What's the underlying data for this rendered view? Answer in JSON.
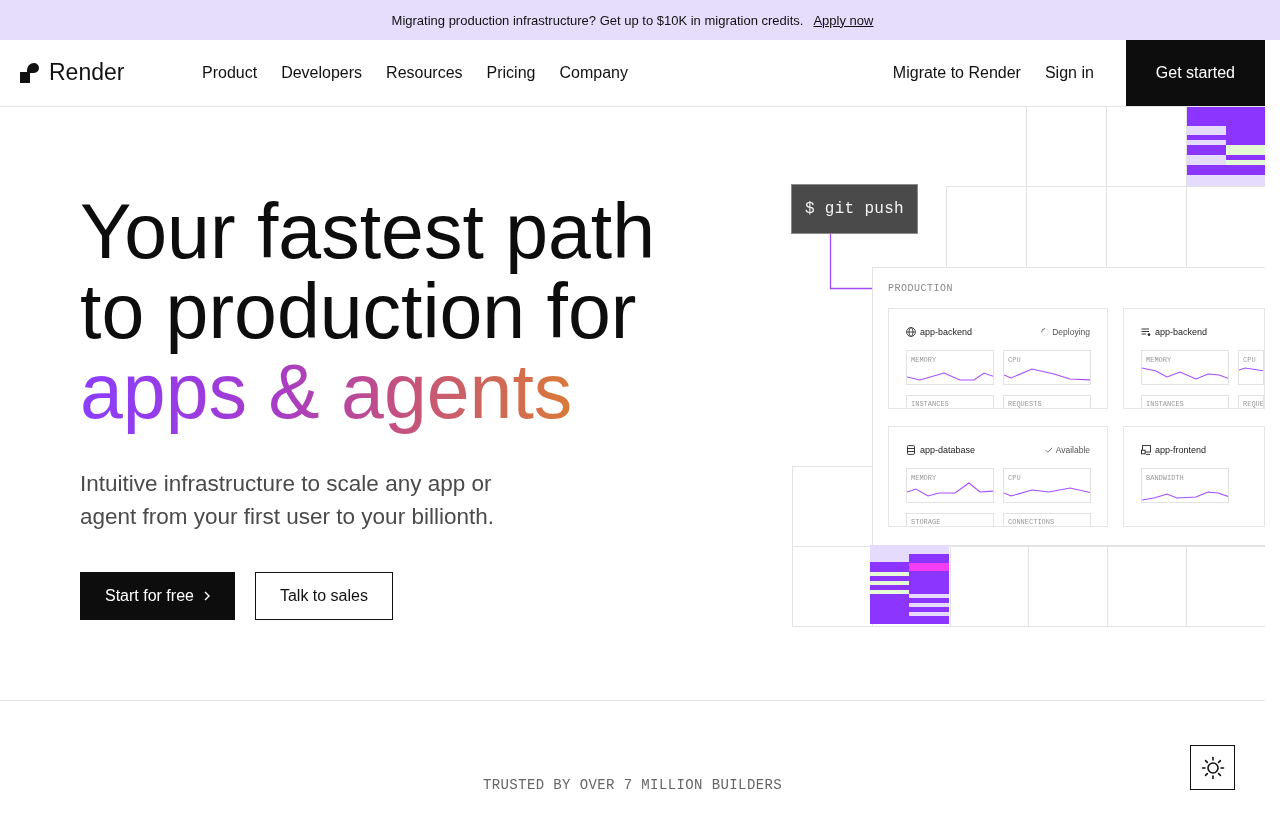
{
  "banner": {
    "text": "Migrating production infrastructure? Get up to $10K in migration credits.",
    "link": "Apply now"
  },
  "nav": {
    "brand": "Render",
    "links": [
      "Product",
      "Developers",
      "Resources",
      "Pricing",
      "Company"
    ],
    "actions": [
      {
        "label": "Migrate to Render",
        "kind": "link"
      },
      {
        "label": "Sign in",
        "kind": "link"
      },
      {
        "label": "Get started",
        "kind": "primary"
      }
    ]
  },
  "hero": {
    "heading": "Your fastest path to production for",
    "highlight": "apps & agents",
    "subheading": "Intuitive infrastructure to scale any app or agent from your first user to your billionth.",
    "buttons": [
      {
        "label": "Start for free",
        "kind": "primary"
      },
      {
        "label": "Talk to sales",
        "kind": "secondary"
      }
    ]
  },
  "illustration": {
    "command": "$ git push",
    "panel": {
      "title": "PRODUCTION",
      "services": [
        {
          "kind": "web",
          "name": "app-backend",
          "status": {
            "kind": "deploying",
            "label": "Deploying"
          },
          "metrics": [
            "MEMORY",
            "CPU"
          ],
          "more_metrics": [
            "INSTANCES",
            "REQUESTS"
          ]
        },
        {
          "kind": "worker",
          "name": "app-backend",
          "metrics": [
            "MEMORY",
            "CPU"
          ],
          "more_metrics": [
            "INSTANCES",
            "REQUE"
          ]
        },
        {
          "kind": "database",
          "name": "app-database",
          "status": {
            "kind": "available",
            "label": "Available"
          },
          "metrics": [
            "MEMORY",
            "CPU"
          ],
          "more_metrics": [
            "STORAGE",
            "CONNECTIONS"
          ]
        },
        {
          "kind": "static",
          "name": "app-frontend",
          "metrics": [
            "BANDWIDTH"
          ]
        }
      ]
    }
  },
  "trusted": "TRUSTED BY OVER 7 MILLION BUILDERS"
}
